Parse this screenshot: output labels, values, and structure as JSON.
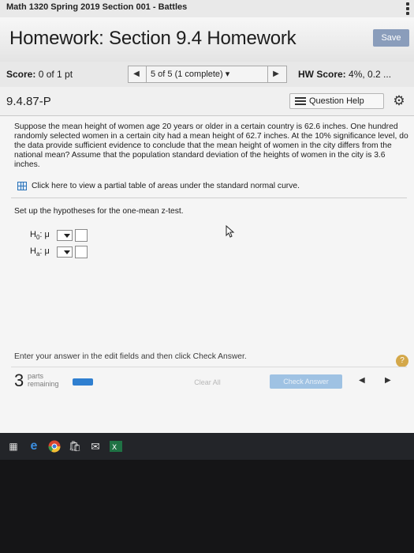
{
  "course": {
    "title": "Math 1320 Spring 2019 Section 001 - Battles"
  },
  "header": {
    "title": "Homework: Section 9.4 Homework",
    "save_label": "Save"
  },
  "score_bar": {
    "score_label": "Score:",
    "score_value": "0 of 1 pt",
    "nav_selector": "5 of 5 (1 complete)",
    "hw_score_label": "HW Score:",
    "hw_score_value": "4%, 0.2 ..."
  },
  "question_bar": {
    "id": "9.4.87-P",
    "help_label": "Question Help"
  },
  "question": {
    "text": "Suppose the mean height of women age 20 years or older in a certain country is 62.6 inches. One hundred randomly selected women in a certain city had a mean height of 62.7 inches. At the 10% significance level, do the data provide sufficient evidence to conclude that the mean height of women in the city differs from the national mean? Assume that the population standard deviation of the heights of women in the city is 3.6 inches.",
    "table_link": "Click here to view a partial table of areas under the standard normal curve.",
    "setup_prompt": "Set up the hypotheses for the one-mean z-test."
  },
  "hypotheses": [
    {
      "symbol": "H",
      "sub": "0",
      "param": "μ"
    },
    {
      "symbol": "H",
      "sub": "a",
      "param": "μ"
    }
  ],
  "footer": {
    "instruction": "Enter your answer in the edit fields and then click Check Answer.",
    "parts_count": "3",
    "parts_label_1": "parts",
    "parts_label_2": "remaining",
    "clear_all": "Clear All",
    "check_answer": "Check Answer",
    "help_symbol": "?"
  },
  "colors": {
    "accent": "#2f7fd0",
    "save_button": "#8a9dbb",
    "check_button": "#9fc2e3"
  }
}
